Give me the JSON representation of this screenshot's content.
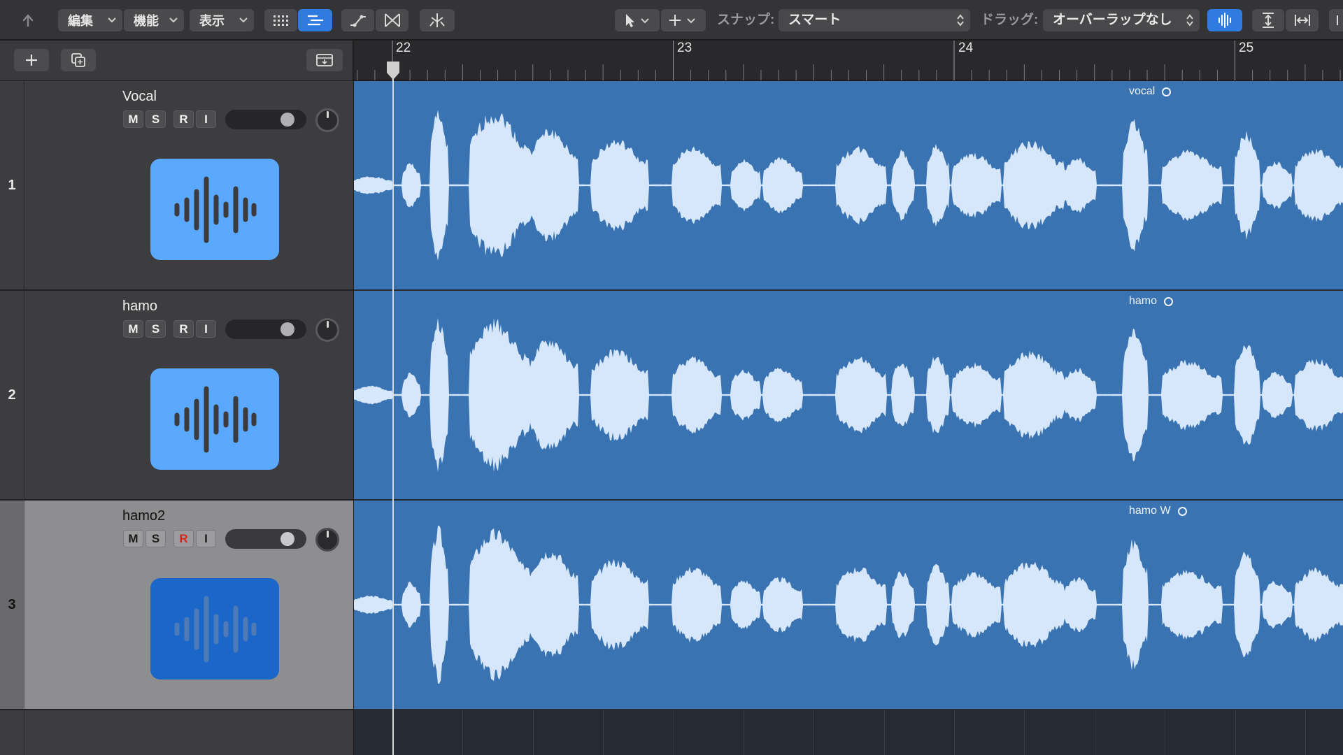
{
  "toolbar": {
    "menus": [
      {
        "label": "編集"
      },
      {
        "label": "機能"
      },
      {
        "label": "表示"
      }
    ],
    "snap_label": "スナップ:",
    "snap_value": "スマート",
    "drag_label": "ドラッグ:",
    "drag_value": "オーバーラップなし"
  },
  "ruler": {
    "bars": [
      "22",
      "23",
      "24",
      "25"
    ]
  },
  "tracks": [
    {
      "number": "1",
      "name": "Vocal",
      "mute": "M",
      "solo": "S",
      "record": "R",
      "input": "I",
      "region_name": "vocal",
      "selected": false
    },
    {
      "number": "2",
      "name": "hamo",
      "mute": "M",
      "solo": "S",
      "record": "R",
      "input": "I",
      "region_name": "hamo",
      "selected": false
    },
    {
      "number": "3",
      "name": "hamo2",
      "mute": "M",
      "solo": "S",
      "record": "R",
      "input": "I",
      "region_name": "hamo W",
      "selected": true
    }
  ],
  "colors": {
    "region": "#3a73b1",
    "waveform": "#d6e6fb",
    "track_icon": "#5aa9ff",
    "track_icon_selected": "#1a66c9",
    "record_armed": "#d8241c"
  }
}
